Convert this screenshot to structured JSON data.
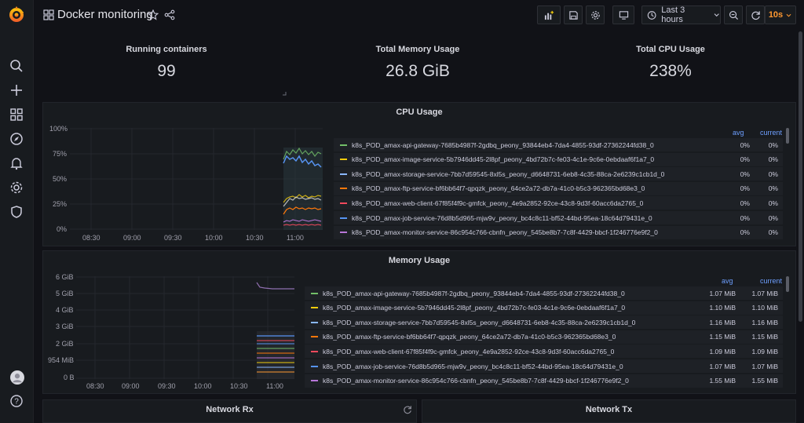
{
  "colors": {
    "brand": "#f46800",
    "accent_blue": "#6e9fff",
    "refresh_orange": "#ff9830"
  },
  "sidebar": {
    "items": [
      {
        "name": "search-icon"
      },
      {
        "name": "plus-icon"
      },
      {
        "name": "dashboards-icon"
      },
      {
        "name": "explore-icon"
      },
      {
        "name": "alerting-bell-icon"
      },
      {
        "name": "settings-gear-icon"
      },
      {
        "name": "shield-icon"
      }
    ],
    "bottom": [
      {
        "name": "user-avatar-icon"
      },
      {
        "name": "help-icon"
      }
    ]
  },
  "topbar": {
    "title": "Docker monitoring",
    "time_range": "Last 3 hours",
    "refresh_interval": "10s"
  },
  "stats": [
    {
      "title": "Running containers",
      "value": "99"
    },
    {
      "title": "Total Memory Usage",
      "value": "26.8 GiB"
    },
    {
      "title": "Total CPU Usage",
      "value": "238%"
    }
  ],
  "cpu_panel": {
    "title": "CPU Usage",
    "y_ticks": [
      "100%",
      "75%",
      "50%",
      "25%",
      "0%"
    ],
    "x_ticks": [
      "08:30",
      "09:00",
      "09:30",
      "10:00",
      "10:30",
      "11:00"
    ],
    "legend_avg": "avg",
    "legend_current": "current",
    "legend": [
      {
        "name": "k8s_POD_amax-api-gateway-7685b4987f-2gdbq_peony_93844eb4-7da4-4855-93df-27362244fd38_0",
        "avg": "0%",
        "current": "0%",
        "color": "#73bf69"
      },
      {
        "name": "k8s_POD_amax-image-service-5b7946dd45-2l8pf_peony_4bd72b7c-fe03-4c1e-9c6e-0ebdaaf6f1a7_0",
        "avg": "0%",
        "current": "0%",
        "color": "#f2cc0c"
      },
      {
        "name": "k8s_POD_amax-storage-service-7bb7d59545-8xl5s_peony_d6648731-6eb8-4c35-88ca-2e6239c1cb1d_0",
        "avg": "0%",
        "current": "0%",
        "color": "#8ab8ff"
      },
      {
        "name": "k8s_POD_amax-ftp-service-bf6bb64f7-qpqzk_peony_64ce2a72-db7a-41c0-b5c3-962365bd68e3_0",
        "avg": "0%",
        "current": "0%",
        "color": "#ff780a"
      },
      {
        "name": "k8s_POD_amax-web-client-67f85f4f9c-gmfck_peony_4e9a2852-92ce-43c8-9d3f-60acc6da2765_0",
        "avg": "0%",
        "current": "0%",
        "color": "#f2495c"
      },
      {
        "name": "k8s_POD_amax-job-service-76d8b5d965-mjw9v_peony_bc4c8c11-bf52-44bd-95ea-18c64d79431e_0",
        "avg": "0%",
        "current": "0%",
        "color": "#5794f2"
      },
      {
        "name": "k8s_POD_amax-monitor-service-86c954c766-cbnfn_peony_545be8b7-7c8f-4429-bbcf-1f246776e9f2_0",
        "avg": "0%",
        "current": "0%",
        "color": "#b877d9"
      }
    ]
  },
  "memory_panel": {
    "title": "Memory Usage",
    "y_ticks": [
      "6 GiB",
      "5 GiB",
      "4 GiB",
      "3 GiB",
      "2 GiB",
      "954 MiB",
      "0 B"
    ],
    "x_ticks": [
      "08:30",
      "09:00",
      "09:30",
      "10:00",
      "10:30",
      "11:00"
    ],
    "legend_avg": "avg",
    "legend_current": "current",
    "legend": [
      {
        "name": "k8s_POD_amax-api-gateway-7685b4987f-2gdbq_peony_93844eb4-7da4-4855-93df-27362244fd38_0",
        "avg": "1.07 MiB",
        "current": "1.07 MiB",
        "color": "#73bf69"
      },
      {
        "name": "k8s_POD_amax-image-service-5b7946dd45-2l8pf_peony_4bd72b7c-fe03-4c1e-9c6e-0ebdaaf6f1a7_0",
        "avg": "1.10 MiB",
        "current": "1.10 MiB",
        "color": "#f2cc0c"
      },
      {
        "name": "k8s_POD_amax-storage-service-7bb7d59545-8xl5s_peony_d6648731-6eb8-4c35-88ca-2e6239c1cb1d_0",
        "avg": "1.16 MiB",
        "current": "1.16 MiB",
        "color": "#8ab8ff"
      },
      {
        "name": "k8s_POD_amax-ftp-service-bf6bb64f7-qpqzk_peony_64ce2a72-db7a-41c0-b5c3-962365bd68e3_0",
        "avg": "1.15 MiB",
        "current": "1.15 MiB",
        "color": "#ff780a"
      },
      {
        "name": "k8s_POD_amax-web-client-67f85f4f9c-gmfck_peony_4e9a2852-92ce-43c8-9d3f-60acc6da2765_0",
        "avg": "1.09 MiB",
        "current": "1.09 MiB",
        "color": "#f2495c"
      },
      {
        "name": "k8s_POD_amax-job-service-76d8b5d965-mjw9v_peony_bc4c8c11-bf52-44bd-95ea-18c64d79431e_0",
        "avg": "1.07 MiB",
        "current": "1.07 MiB",
        "color": "#5794f2"
      },
      {
        "name": "k8s_POD_amax-monitor-service-86c954c766-cbnfn_peony_545be8b7-7c8f-4429-bbcf-1f246776e9f2_0",
        "avg": "1.55 MiB",
        "current": "1.55 MiB",
        "color": "#b877d9"
      }
    ]
  },
  "network": {
    "rx_title": "Network Rx",
    "tx_title": "Network Tx"
  }
}
